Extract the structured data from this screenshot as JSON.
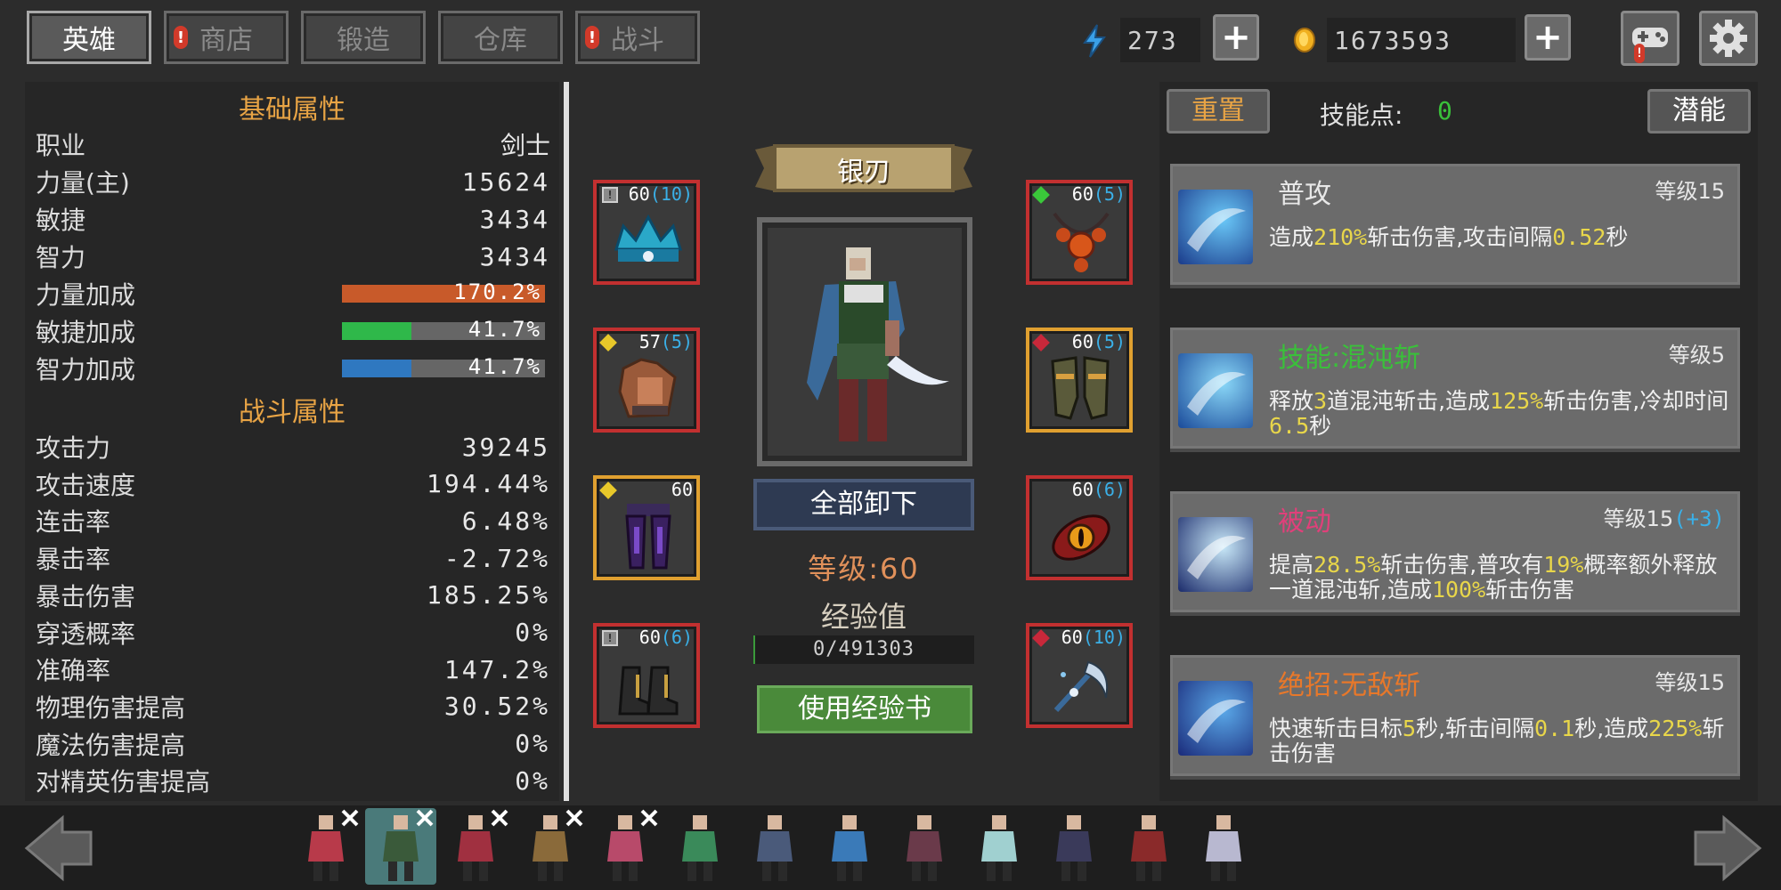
{
  "tabs": [
    {
      "label": "英雄",
      "active": true,
      "alert": false
    },
    {
      "label": "商店",
      "active": false,
      "alert": true
    },
    {
      "label": "锻造",
      "active": false,
      "alert": false
    },
    {
      "label": "仓库",
      "active": false,
      "alert": false
    },
    {
      "label": "战斗",
      "active": false,
      "alert": true
    }
  ],
  "resources": {
    "energy": "273",
    "gold": "1673593",
    "energy_icon": "lightning-icon",
    "gold_icon": "gold-coin-icon"
  },
  "stats": {
    "basic_title": "基础属性",
    "combat_title": "战斗属性",
    "basic": [
      {
        "label": "职业",
        "value": "剑士"
      },
      {
        "label": "力量(主)",
        "value": "15624"
      },
      {
        "label": "敏捷",
        "value": "3434"
      },
      {
        "label": "智力",
        "value": "3434"
      }
    ],
    "bonuses": [
      {
        "label": "力量加成",
        "value": "170.2%",
        "fill": 1.0,
        "color": "#c85a2a"
      },
      {
        "label": "敏捷加成",
        "value": "41.7%",
        "fill": 0.34,
        "color": "#2fb84a"
      },
      {
        "label": "智力加成",
        "value": "41.7%",
        "fill": 0.34,
        "color": "#2f78c0"
      }
    ],
    "combat": [
      {
        "label": "攻击力",
        "value": "39245"
      },
      {
        "label": "攻击速度",
        "value": "194.44%"
      },
      {
        "label": "连击率",
        "value": "6.48%"
      },
      {
        "label": "暴击率",
        "value": "-2.72%"
      },
      {
        "label": "暴击伤害",
        "value": "185.25%"
      },
      {
        "label": "穿透概率",
        "value": "0%"
      },
      {
        "label": "准确率",
        "value": "147.2%"
      },
      {
        "label": "物理伤害提高",
        "value": "30.52%"
      },
      {
        "label": "魔法伤害提高",
        "value": "0%"
      },
      {
        "label": "对精英伤害提高",
        "value": "0%"
      }
    ]
  },
  "hero": {
    "name": "银刃",
    "unequip_label": "全部卸下",
    "level_label": "等级:60",
    "exp_title": "经验值",
    "exp_value": "0/491303",
    "exp_fraction": 0.01,
    "exp_book_label": "使用经验书"
  },
  "equipment": {
    "left": [
      {
        "level": "60",
        "bonus": "(10)",
        "item": "crown-icon",
        "border": "red",
        "marker": "lock"
      },
      {
        "level": "57",
        "bonus": "(5)",
        "item": "leather-armor-icon",
        "border": "red",
        "marker": "gem-yellow"
      },
      {
        "level": "60",
        "bonus": "",
        "item": "purple-leggings-icon",
        "border": "gold",
        "marker": "gem-yellow"
      },
      {
        "level": "60",
        "bonus": "(6)",
        "item": "boots-icon",
        "border": "red",
        "marker": "lock"
      }
    ],
    "right": [
      {
        "level": "60",
        "bonus": "(5)",
        "item": "amber-necklace-icon",
        "border": "red",
        "marker": "gem-green"
      },
      {
        "level": "60",
        "bonus": "(5)",
        "item": "gauntlets-icon",
        "border": "gold",
        "marker": "gem-red"
      },
      {
        "level": "60",
        "bonus": "(6)",
        "item": "eye-ring-icon",
        "border": "red",
        "marker": "none"
      },
      {
        "level": "60",
        "bonus": "(10)",
        "item": "scythe-charm-icon",
        "border": "red",
        "marker": "gem-red"
      }
    ]
  },
  "skills_panel": {
    "reset_label": "重置",
    "points_label": "技能点:",
    "points_value": "0",
    "potential_label": "潜能"
  },
  "skills": [
    {
      "name": "普攻",
      "name_color": "#e8e8e8",
      "level": "等级15",
      "level_bonus": "",
      "desc": [
        [
          "造成",
          false
        ],
        [
          "210%",
          true
        ],
        [
          "斩击伤害,攻击间隔",
          false
        ],
        [
          "0.52",
          true
        ],
        [
          "秒",
          false
        ]
      ]
    },
    {
      "name": "技能:混沌斩",
      "name_color": "#3ac03a",
      "level": "等级5",
      "level_bonus": "",
      "desc": [
        [
          "释放",
          false
        ],
        [
          "3",
          true
        ],
        [
          "道混沌斩击,造成",
          false
        ],
        [
          "125%",
          true
        ],
        [
          "斩击伤害,冷却时间",
          false
        ],
        [
          "6.5",
          true
        ],
        [
          "秒",
          false
        ]
      ]
    },
    {
      "name": "被动",
      "name_color": "#e0407a",
      "level": "等级15",
      "level_bonus": "(+3)",
      "desc": [
        [
          "提高",
          false
        ],
        [
          "28.5%",
          true
        ],
        [
          "斩击伤害,普攻有",
          false
        ],
        [
          "19%",
          true
        ],
        [
          "概率额外释放一道混沌斩,造成",
          false
        ],
        [
          "100%",
          true
        ],
        [
          "斩击伤害",
          false
        ]
      ]
    },
    {
      "name": "绝招:无敌斩",
      "name_color": "#e8782a",
      "level": "等级15",
      "level_bonus": "",
      "desc": [
        [
          "快速斩击目标",
          false
        ],
        [
          "5",
          true
        ],
        [
          "秒,斩击间隔",
          false
        ],
        [
          "0.1",
          true
        ],
        [
          "秒,造成",
          false
        ],
        [
          "225%",
          true
        ],
        [
          "斩击伤害",
          false
        ]
      ]
    }
  ],
  "roster": {
    "heroes": [
      {
        "name": "hero-1",
        "color": "#b83a4a",
        "equipped": true
      },
      {
        "name": "hero-2",
        "color": "#3a5a3a",
        "equipped": true,
        "selected": true
      },
      {
        "name": "hero-3",
        "color": "#a03040",
        "equipped": true
      },
      {
        "name": "hero-4",
        "color": "#8a6a3a",
        "equipped": true
      },
      {
        "name": "hero-5",
        "color": "#b84a6a",
        "equipped": true
      },
      {
        "name": "hero-6",
        "color": "#3a8a5a",
        "equipped": false
      },
      {
        "name": "hero-7",
        "color": "#4a5a7a",
        "equipped": false
      },
      {
        "name": "hero-8",
        "color": "#3a7ab8",
        "equipped": false
      },
      {
        "name": "hero-9",
        "color": "#6a3a4a",
        "equipped": false
      },
      {
        "name": "hero-10",
        "color": "#a0d0d0",
        "equipped": false
      },
      {
        "name": "hero-11",
        "color": "#3a3a5a",
        "equipped": false
      },
      {
        "name": "hero-12",
        "color": "#8a2a2a",
        "equipped": false
      },
      {
        "name": "hero-13",
        "color": "#b8b8d0",
        "equipped": false
      }
    ]
  }
}
